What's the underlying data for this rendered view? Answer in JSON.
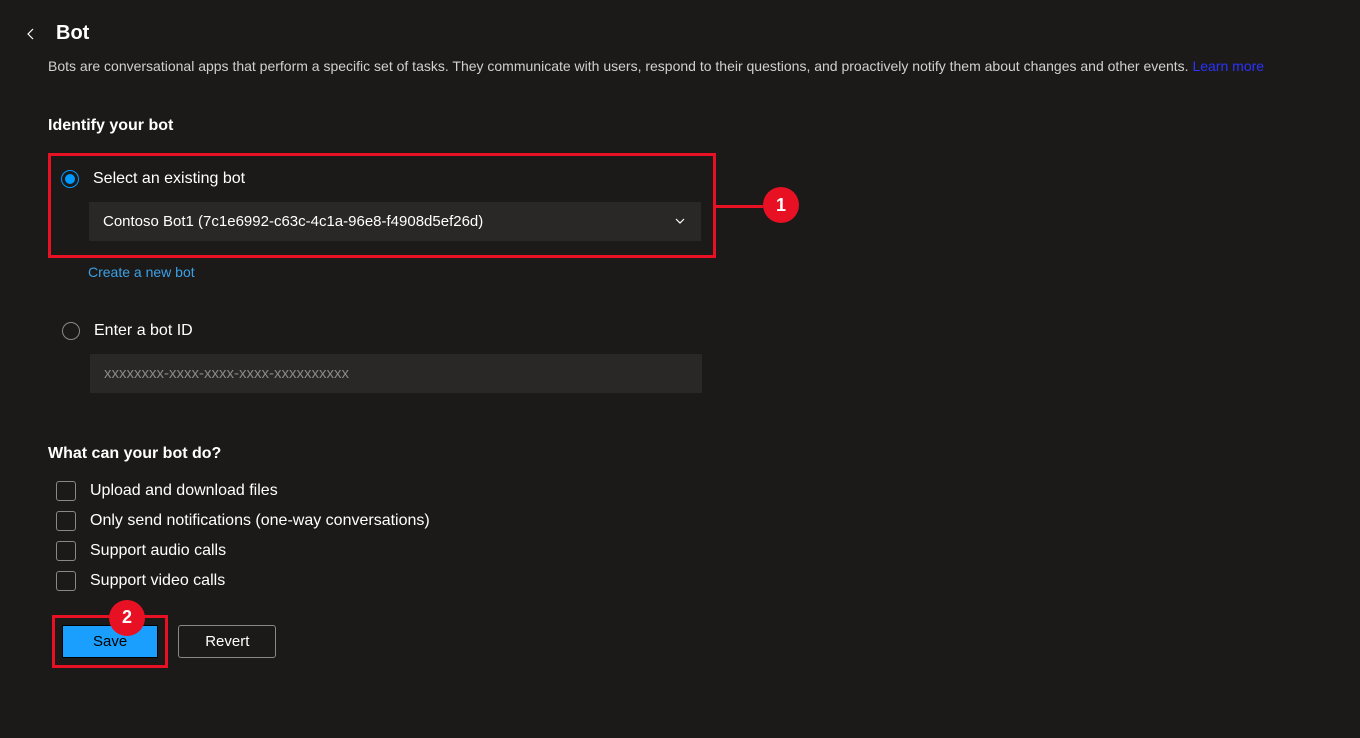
{
  "header": {
    "title": "Bot",
    "description": "Bots are conversational apps that perform a specific set of tasks. They communicate with users, respond to their questions, and proactively notify them about changes and other events.",
    "learn_more": "Learn more"
  },
  "identify": {
    "title": "Identify your bot",
    "option_existing": "Select an existing bot",
    "selected_bot": "Contoso Bot1 (7c1e6992-c63c-4c1a-96e8-f4908d5ef26d)",
    "create_new": "Create a new bot",
    "option_enter_id": "Enter a bot ID",
    "id_placeholder": "xxxxxxxx-xxxx-xxxx-xxxx-xxxxxxxxxx"
  },
  "capabilities": {
    "title": "What can your bot do?",
    "items": [
      {
        "label": "Upload and download files"
      },
      {
        "label": "Only send notifications (one-way conversations)"
      },
      {
        "label": "Support audio calls"
      },
      {
        "label": "Support video calls"
      }
    ]
  },
  "buttons": {
    "save": "Save",
    "revert": "Revert"
  },
  "callouts": {
    "one": "1",
    "two": "2"
  }
}
